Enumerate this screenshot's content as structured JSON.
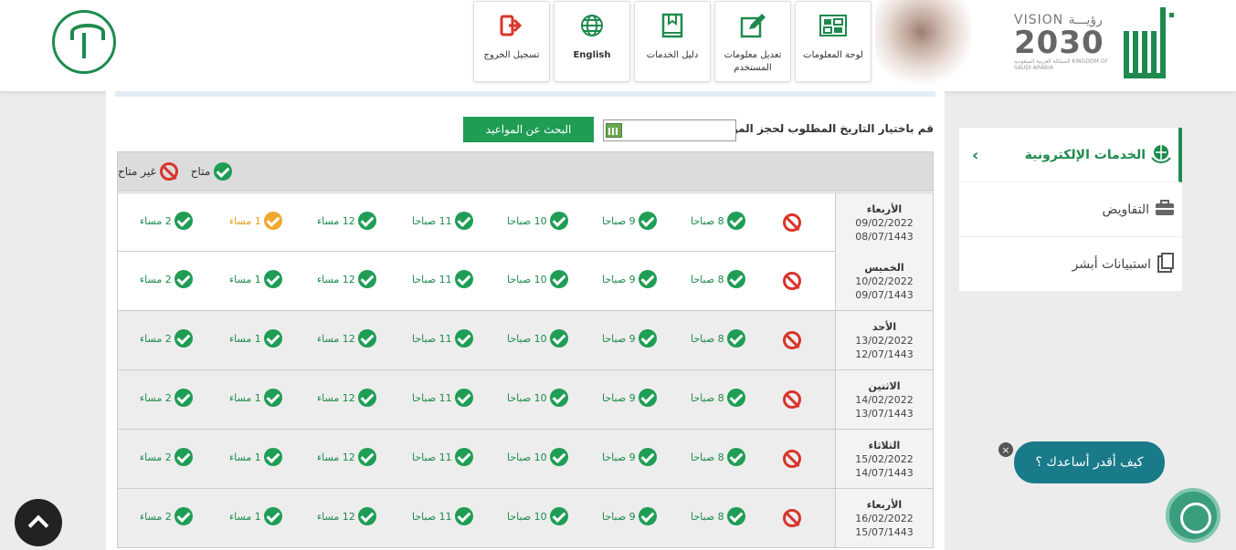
{
  "header": {
    "nav": [
      {
        "label": "تسجيل الخروج",
        "icon": "logout-icon"
      },
      {
        "label": "English",
        "icon": "globe-icon"
      },
      {
        "label": "دليل الخدمات",
        "icon": "book-icon"
      },
      {
        "label": "تعديل معلومات المستخدم",
        "icon": "edit-icon"
      },
      {
        "label": "لوحة المعلومات",
        "icon": "dashboard-icon"
      }
    ],
    "vision_text": "VISION رؤيـــة",
    "vision_year": "2030",
    "vision_sub": "المملكة العربية السعودية KINGDOM OF SAUDI ARABIA",
    "absher_logo": "أبشر"
  },
  "sidebar": {
    "items": [
      {
        "label": "الخدمات الإلكترونية",
        "icon": "globe-hands-icon"
      },
      {
        "label": "التفاويض",
        "icon": "briefcase-icon"
      },
      {
        "label": "استبيانات أبشر",
        "icon": "clipboard-icon"
      }
    ]
  },
  "form": {
    "date_label": "قم باختيار التاريخ المطلوب لحجز الموعد :",
    "date_value": "",
    "search_button": "البحث عن المواعيد"
  },
  "legend": {
    "available": "متاح",
    "unavailable": "غير متاح"
  },
  "slots": [
    "8 صباحا",
    "9 صباحا",
    "10 صباحا",
    "11 صباحا",
    "12 مساء",
    "1 مساء",
    "2 مساء"
  ],
  "days": [
    {
      "name": "الأربعاء",
      "greg": "09/02/2022",
      "hijri": "08/07/1443"
    },
    {
      "name": "الخميس",
      "greg": "10/02/2022",
      "hijri": "09/07/1443"
    },
    {
      "name": "الأحد",
      "greg": "13/02/2022",
      "hijri": "12/07/1443"
    },
    {
      "name": "الاثنين",
      "greg": "14/02/2022",
      "hijri": "13/07/1443"
    },
    {
      "name": "الثلاثاء",
      "greg": "15/02/2022",
      "hijri": "14/07/1443"
    },
    {
      "name": "الأربعاء",
      "greg": "16/02/2022",
      "hijri": "15/07/1443"
    }
  ],
  "chat": {
    "label": "كيف أقدر أساعدك ؟",
    "close": "×"
  }
}
